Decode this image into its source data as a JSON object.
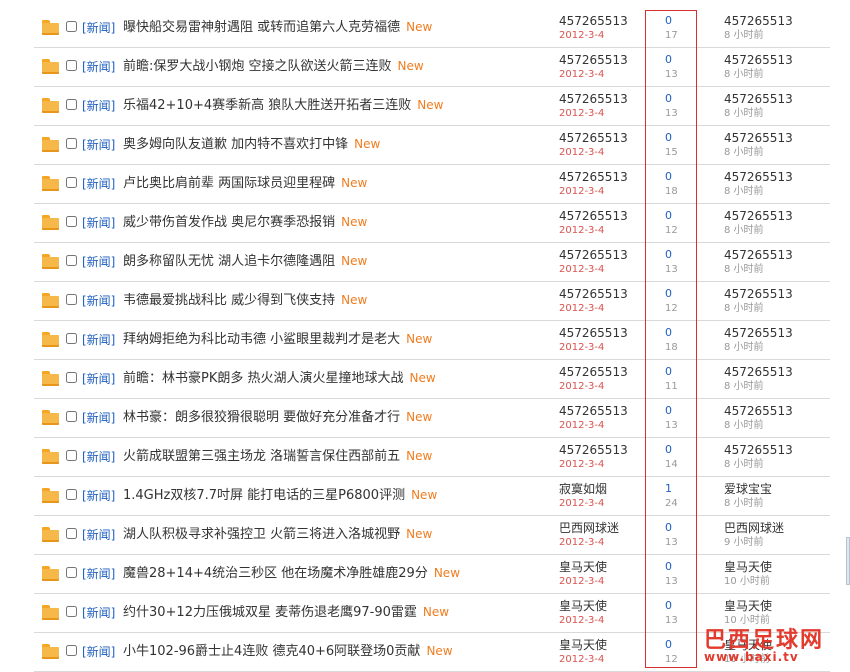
{
  "category_label": "[新闻]",
  "new_label": "New",
  "topics": [
    {
      "title": "曝快船交易雷神射遇阻 或转而追第六人克劳福德",
      "author": "457265513",
      "date": "2012-3-4",
      "replies": "0",
      "views": "17",
      "last_user": "457265513",
      "last_time": "8 小时前"
    },
    {
      "title": "前瞻:保罗大战小钢炮 空接之队欲送火箭三连败",
      "author": "457265513",
      "date": "2012-3-4",
      "replies": "0",
      "views": "13",
      "last_user": "457265513",
      "last_time": "8 小时前"
    },
    {
      "title": "乐福42+10+4赛季新高 狼队大胜送开拓者三连败",
      "author": "457265513",
      "date": "2012-3-4",
      "replies": "0",
      "views": "13",
      "last_user": "457265513",
      "last_time": "8 小时前"
    },
    {
      "title": "奥多姆向队友道歉 加内特不喜欢打中锋",
      "author": "457265513",
      "date": "2012-3-4",
      "replies": "0",
      "views": "15",
      "last_user": "457265513",
      "last_time": "8 小时前"
    },
    {
      "title": "卢比奥比肩前辈 两国际球员迎里程碑",
      "author": "457265513",
      "date": "2012-3-4",
      "replies": "0",
      "views": "18",
      "last_user": "457265513",
      "last_time": "8 小时前"
    },
    {
      "title": "威少带伤首发作战 奥尼尔赛季恐报销",
      "author": "457265513",
      "date": "2012-3-4",
      "replies": "0",
      "views": "12",
      "last_user": "457265513",
      "last_time": "8 小时前"
    },
    {
      "title": "朗多称留队无忧 湖人追卡尔德隆遇阻",
      "author": "457265513",
      "date": "2012-3-4",
      "replies": "0",
      "views": "13",
      "last_user": "457265513",
      "last_time": "8 小时前"
    },
    {
      "title": "韦德最爱挑战科比 威少得到飞侠支持",
      "author": "457265513",
      "date": "2012-3-4",
      "replies": "0",
      "views": "12",
      "last_user": "457265513",
      "last_time": "8 小时前"
    },
    {
      "title": "拜纳姆拒绝为科比动韦德 小鲨眼里裁判才是老大",
      "author": "457265513",
      "date": "2012-3-4",
      "replies": "0",
      "views": "18",
      "last_user": "457265513",
      "last_time": "8 小时前"
    },
    {
      "title": "前瞻：林书豪PK朗多 热火湖人演火星撞地球大战",
      "author": "457265513",
      "date": "2012-3-4",
      "replies": "0",
      "views": "11",
      "last_user": "457265513",
      "last_time": "8 小时前"
    },
    {
      "title": "林书豪：朗多很狡猾很聪明 要做好充分准备才行",
      "author": "457265513",
      "date": "2012-3-4",
      "replies": "0",
      "views": "13",
      "last_user": "457265513",
      "last_time": "8 小时前"
    },
    {
      "title": "火箭成联盟第三强主场龙 洛瑞誓言保住西部前五",
      "author": "457265513",
      "date": "2012-3-4",
      "replies": "0",
      "views": "14",
      "last_user": "457265513",
      "last_time": "8 小时前"
    },
    {
      "title": "1.4GHz双核7.7吋屏 能打电话的三星P6800评测",
      "author": "寂寞如烟",
      "date": "2012-3-4",
      "replies": "1",
      "views": "24",
      "last_user": "爱球宝宝",
      "last_time": "8 小时前"
    },
    {
      "title": "湖人队积极寻求补强控卫 火箭三将进入洛城视野",
      "author": "巴西网球迷",
      "date": "2012-3-4",
      "replies": "0",
      "views": "13",
      "last_user": "巴西网球迷",
      "last_time": "9 小时前"
    },
    {
      "title": "魔兽28+14+4统治三秒区 他在场魔术净胜雄鹿29分",
      "author": "皇马天使",
      "date": "2012-3-4",
      "replies": "0",
      "views": "13",
      "last_user": "皇马天使",
      "last_time": "10 小时前"
    },
    {
      "title": "约什30+12力压俄城双星 麦蒂伤退老鹰97-90雷霆",
      "author": "皇马天使",
      "date": "2012-3-4",
      "replies": "0",
      "views": "13",
      "last_user": "皇马天使",
      "last_time": "10 小时前"
    },
    {
      "title": "小牛102-96爵士止4连败 德克40+6阿联登场0贡献",
      "author": "皇马天使",
      "date": "2012-3-4",
      "replies": "0",
      "views": "12",
      "last_user": "皇马天使",
      "last_time": "10 小时前"
    }
  ],
  "watermark": {
    "name": "巴西足球网",
    "url": "www.baxi.tv"
  }
}
